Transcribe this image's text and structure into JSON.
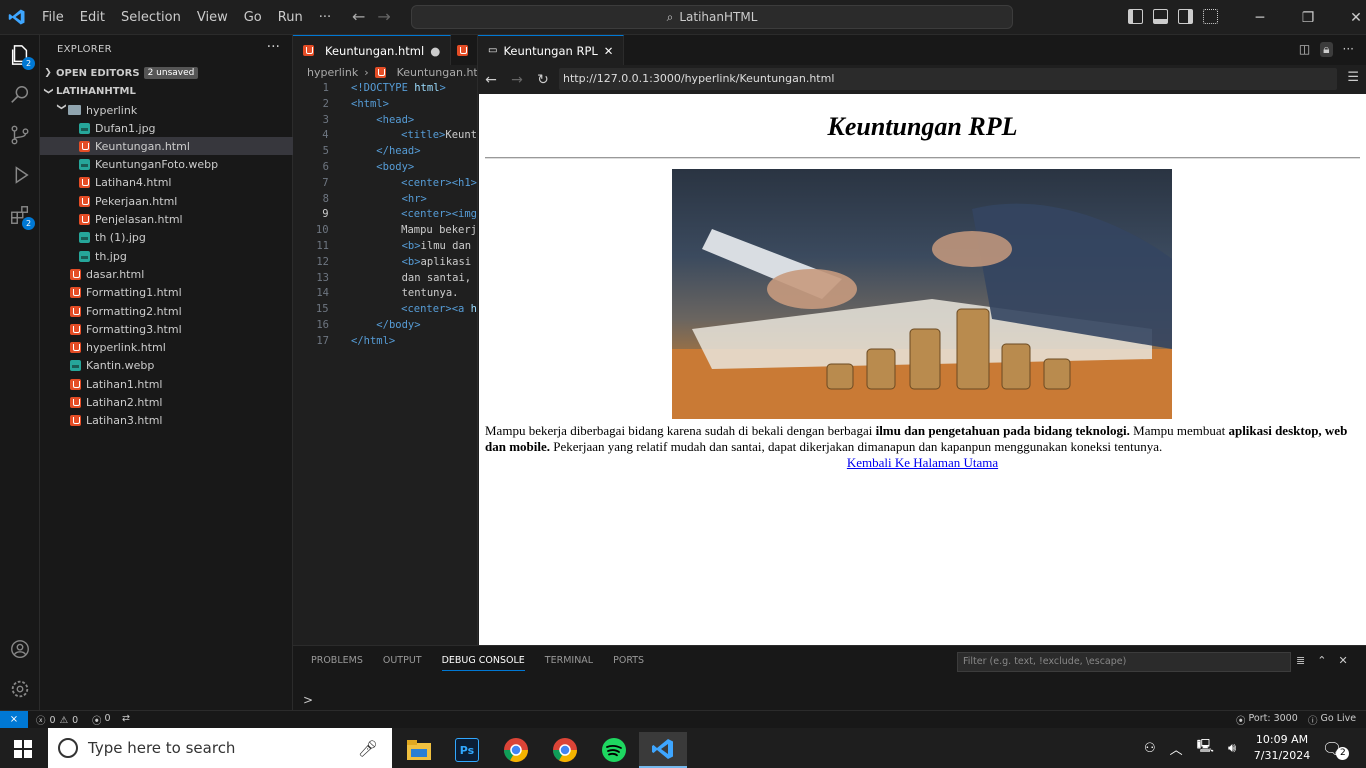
{
  "menu": [
    "File",
    "Edit",
    "Selection",
    "View",
    "Go",
    "Run",
    "···"
  ],
  "command_center": "LatihanHTML",
  "activity_badges": {
    "explorer": "2",
    "extensions": "2"
  },
  "explorer": {
    "title": "EXPLORER",
    "open_editors": "OPEN EDITORS",
    "unsaved": "2 unsaved",
    "workspace": "LATIHANHTML",
    "folder": "hyperlink",
    "folder_files": [
      {
        "name": "Dufan1.jpg",
        "type": "img"
      },
      {
        "name": "Keuntungan.html",
        "type": "html"
      },
      {
        "name": "KeuntunganFoto.webp",
        "type": "img"
      },
      {
        "name": "Latihan4.html",
        "type": "html"
      },
      {
        "name": "Pekerjaan.html",
        "type": "html"
      },
      {
        "name": "Penjelasan.html",
        "type": "html"
      },
      {
        "name": "th (1).jpg",
        "type": "img"
      },
      {
        "name": "th.jpg",
        "type": "img"
      }
    ],
    "root_files": [
      {
        "name": "dasar.html",
        "type": "html"
      },
      {
        "name": "Formatting1.html",
        "type": "html"
      },
      {
        "name": "Formatting2.html",
        "type": "html"
      },
      {
        "name": "Formatting3.html",
        "type": "html"
      },
      {
        "name": "hyperlink.html",
        "type": "html"
      },
      {
        "name": "Kantin.webp",
        "type": "img"
      },
      {
        "name": "Latihan1.html",
        "type": "html"
      },
      {
        "name": "Latihan2.html",
        "type": "html"
      },
      {
        "name": "Latihan3.html",
        "type": "html"
      }
    ]
  },
  "editor": {
    "tab1": "Keuntungan.html",
    "more": "···",
    "breadcrumb": [
      "hyperlink",
      "Keuntungan.html"
    ],
    "lines": [
      {
        "n": "1",
        "html": "<span class='t'>&lt;!DOCTYPE</span> <span class='a'>html</span><span class='t'>&gt;</span>"
      },
      {
        "n": "2",
        "html": "<span class='t'>&lt;html&gt;</span>"
      },
      {
        "n": "3",
        "html": "    <span class='t'>&lt;head&gt;</span>"
      },
      {
        "n": "4",
        "html": "        <span class='t'>&lt;title&gt;</span>Keunt"
      },
      {
        "n": "5",
        "html": "    <span class='t'>&lt;/head&gt;</span>"
      },
      {
        "n": "6",
        "html": "    <span class='t'>&lt;body&gt;</span>"
      },
      {
        "n": "7",
        "html": "        <span class='t'>&lt;center&gt;&lt;h1&gt;</span>"
      },
      {
        "n": "8",
        "html": "        <span class='t'>&lt;hr&gt;</span>"
      },
      {
        "n": "9",
        "html": "        <span class='t'>&lt;center&gt;&lt;img</span>"
      },
      {
        "n": "10",
        "html": "        Mampu bekerj"
      },
      {
        "n": "11",
        "html": "        <span class='t'>&lt;b&gt;</span>ilmu dan"
      },
      {
        "n": "12",
        "html": "        <span class='t'>&lt;b&gt;</span>aplikasi"
      },
      {
        "n": "13",
        "html": "        dan santai,"
      },
      {
        "n": "14",
        "html": "        tentunya."
      },
      {
        "n": "15",
        "html": "        <span class='t'>&lt;center&gt;&lt;a</span> <span class='a'>h</span>"
      },
      {
        "n": "16",
        "html": "    <span class='t'>&lt;/body&gt;</span>"
      },
      {
        "n": "17",
        "html": "<span class='t'>&lt;/html&gt;</span>"
      }
    ]
  },
  "browser": {
    "tab": "Keuntungan RPL",
    "url": "http://127.0.0.1:3000/hyperlink/Keuntungan.html",
    "heading": "Keuntungan RPL",
    "para_1": "Mampu bekerja diberbagai bidang karena sudah di bekali dengan berbagai ",
    "bold_1": "ilmu dan pengetahuan pada bidang teknologi.",
    "para_2": " Mampu membuat ",
    "bold_2": "aplikasi desktop, web dan mobile.",
    "para_3": " Pekerjaan yang relatif mudah dan santai, dapat dikerjakan dimanapun dan kapanpun menggunakan koneksi tentunya.",
    "link": "Kembali Ke Halaman Utama"
  },
  "panel": {
    "tabs": [
      "PROBLEMS",
      "OUTPUT",
      "DEBUG CONSOLE",
      "TERMINAL",
      "PORTS"
    ],
    "active": "DEBUG CONSOLE",
    "filter_placeholder": "Filter (e.g. text, !exclude, \\escape)",
    "prompt": ">"
  },
  "status": {
    "errors": "0",
    "warnings": "0",
    "ports": "0",
    "port": "Port: 3000",
    "golive": "Go Live"
  },
  "taskbar": {
    "search": "Type here to search",
    "time": "10:09 AM",
    "date": "7/31/2024",
    "notif": "2"
  },
  "colors": {
    "accent": "#0078d4",
    "html_icon": "#e44d26",
    "img_icon": "#26a69a"
  }
}
